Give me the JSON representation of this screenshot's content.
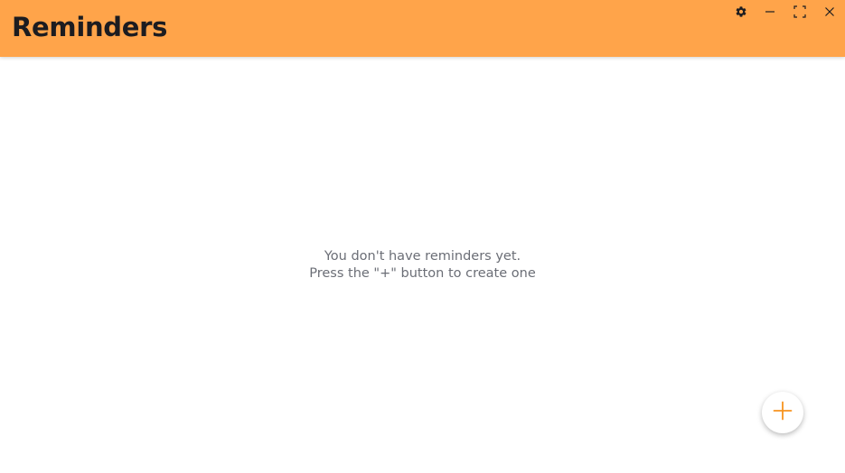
{
  "app": {
    "title": "Reminders"
  },
  "window_controls": {
    "settings_icon": "gear-icon",
    "minimize_icon": "minimize-icon",
    "maximize_icon": "maximize-icon",
    "close_icon": "close-icon"
  },
  "empty_state": {
    "line1": "You don't have reminders yet.",
    "line2": "Press the \"+\" button to create one"
  },
  "fab": {
    "icon": "plus-icon"
  },
  "colors": {
    "header_bg": "#ffa44a",
    "accent": "#f7931e",
    "title_text": "#1c1c20",
    "muted_text": "#6b6e76"
  }
}
